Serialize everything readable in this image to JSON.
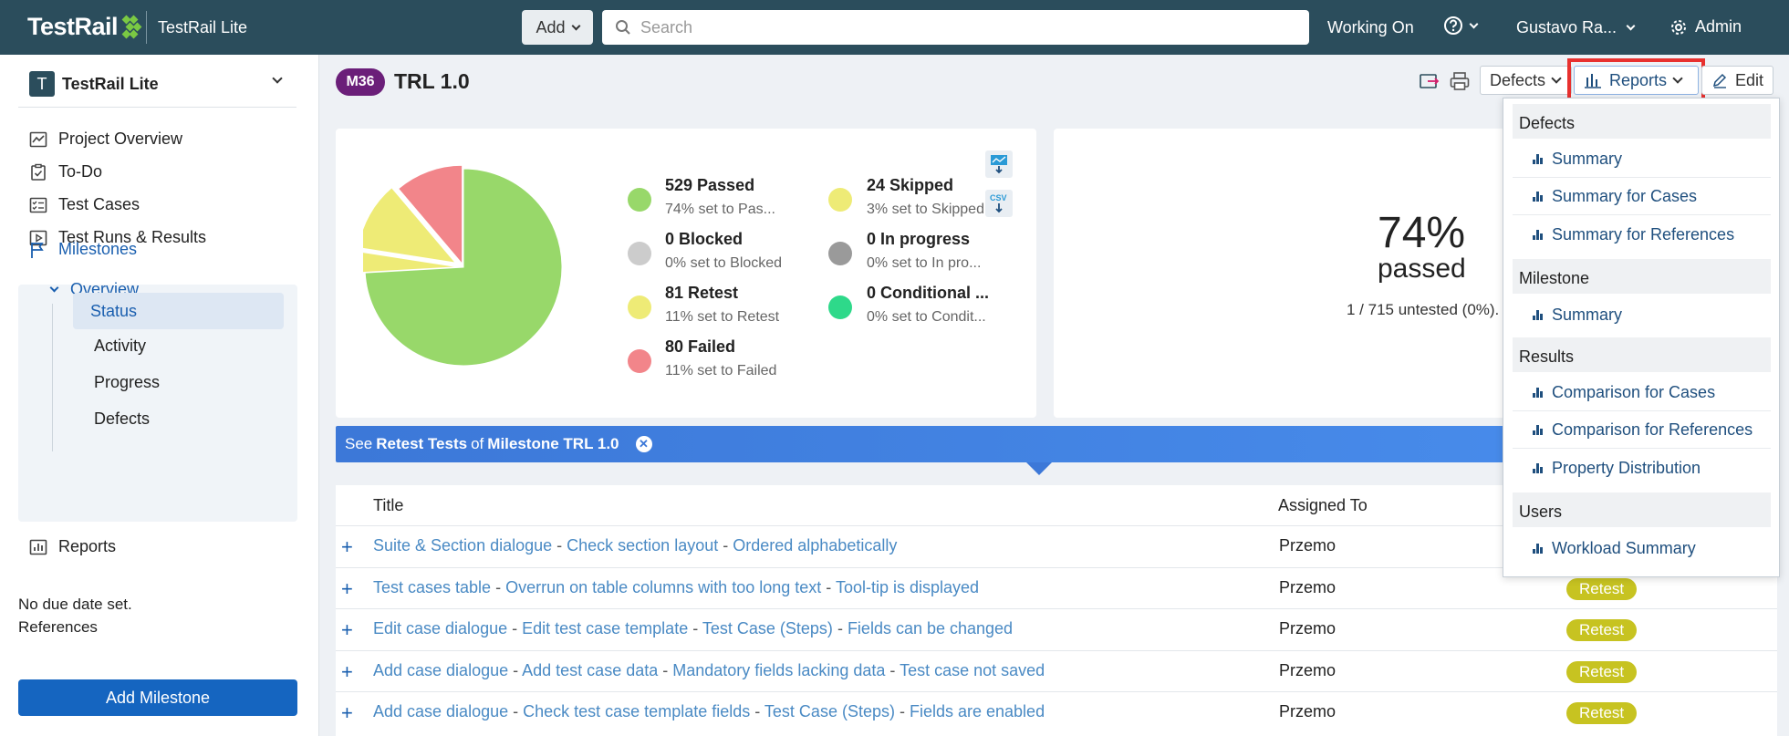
{
  "app": {
    "logo": "TestRail",
    "product": "TestRail Lite"
  },
  "topbar": {
    "add_label": "Add",
    "search_placeholder": "Search",
    "working_on": "Working On",
    "user": "Gustavo Ra...",
    "admin": "Admin"
  },
  "sidebar": {
    "project_initial": "T",
    "project_name": "TestRail Lite",
    "items": [
      {
        "label": "Project Overview"
      },
      {
        "label": "To-Do"
      },
      {
        "label": "Test Cases"
      },
      {
        "label": "Test Runs & Results"
      }
    ],
    "milestones": {
      "label": "Milestones",
      "overview": "Overview",
      "status": "Status",
      "sub": [
        "Activity",
        "Progress",
        "Defects"
      ]
    },
    "reports": "Reports",
    "due_date": "No due date set.",
    "references": "References",
    "add_milestone": "Add Milestone"
  },
  "header": {
    "badge": "M36",
    "title": "TRL 1.0",
    "defects_btn": "Defects",
    "reports_btn": "Reports",
    "edit_btn": "Edit"
  },
  "chart_data": {
    "type": "pie",
    "categories": [
      "Passed",
      "Skipped",
      "Retest",
      "Failed"
    ],
    "values": [
      529,
      24,
      81,
      80
    ],
    "colors": [
      "#98d86a",
      "#eeeb76",
      "#eeeb76",
      "#f2858a"
    ]
  },
  "legend": [
    {
      "name": "529 Passed",
      "sub": "74% set to Pas...",
      "color": "#98d86a"
    },
    {
      "name": "24 Skipped",
      "sub": "3% set to Skipped",
      "color": "#eeeb76"
    },
    {
      "name": "0 Blocked",
      "sub": "0% set to Blocked",
      "color": "#cccccc"
    },
    {
      "name": "0 In progress",
      "sub": "0% set to In pro...",
      "color": "#9a9a9a"
    },
    {
      "name": "81 Retest",
      "sub": "11% set to Retest",
      "color": "#eeeb76"
    },
    {
      "name": "0 Conditional ...",
      "sub": "0% set to Condit...",
      "color": "#2ed98a"
    },
    {
      "name": "80 Failed",
      "sub": "11% set to Failed",
      "color": "#f2858a"
    }
  ],
  "summary": {
    "percent": "74%",
    "passed": "passed",
    "untested": "1 / 715 untested (0%)."
  },
  "banner": {
    "see": "See",
    "bold1": "Retest Tests",
    "of": "of",
    "bold2": "Milestone TRL 1.0"
  },
  "table": {
    "headers": [
      "Title",
      "Assigned To"
    ],
    "rows": [
      {
        "parts": [
          "Suite & Section dialogue",
          "Check section layout",
          "Ordered alphabetically"
        ],
        "assigned": "Przemo",
        "status": ""
      },
      {
        "parts": [
          "Test cases table",
          "Overrun on table columns with too long text",
          "Tool-tip is displayed"
        ],
        "assigned": "Przemo",
        "status": "Retest"
      },
      {
        "parts": [
          "Edit case dialogue",
          "Edit test case template",
          "Test Case (Steps)",
          "Fields can be changed"
        ],
        "assigned": "Przemo",
        "status": "Retest"
      },
      {
        "parts": [
          "Add case dialogue",
          "Add test case data",
          "Mandatory fields lacking data",
          "Test case not saved"
        ],
        "assigned": "Przemo",
        "status": "Retest"
      },
      {
        "parts": [
          "Add case dialogue",
          "Check test case template fields",
          "Test Case (Steps)",
          "Fields are enabled"
        ],
        "assigned": "Przemo",
        "status": "Retest"
      }
    ]
  },
  "reports_menu": {
    "groups": [
      {
        "label": "Defects",
        "items": [
          "Summary",
          "Summary for Cases",
          "Summary for References"
        ]
      },
      {
        "label": "Milestone",
        "items": [
          "Summary"
        ]
      },
      {
        "label": "Results",
        "items": [
          "Comparison for Cases",
          "Comparison for References",
          "Property Distribution"
        ]
      },
      {
        "label": "Users",
        "items": [
          "Workload Summary"
        ]
      }
    ]
  }
}
